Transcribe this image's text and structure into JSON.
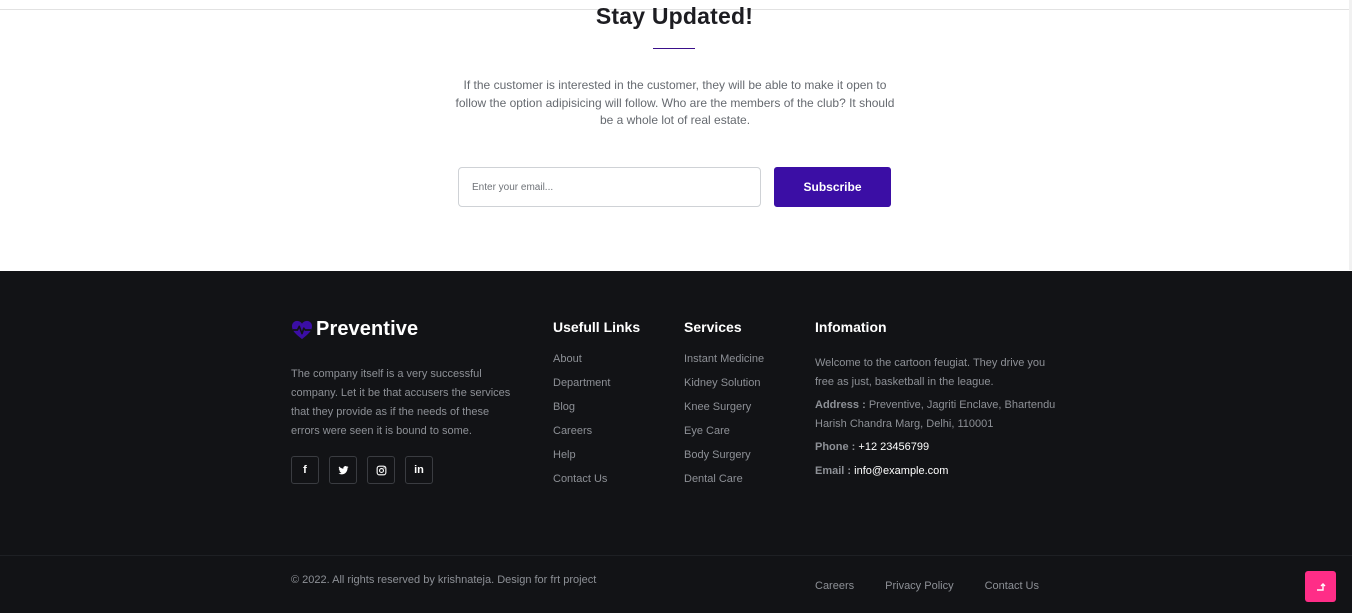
{
  "newsletter": {
    "title": "Stay Updated!",
    "description": "If the customer is interested in the customer, they will be able to make it open to follow the option adipisicing will follow. Who are the members of the club? It should be a whole lot of real estate.",
    "email_placeholder": "Enter your email...",
    "subscribe_label": "Subscribe",
    "button_color": "#3b0ea5"
  },
  "footer": {
    "background": "#121316",
    "brand": {
      "name": "Preventive",
      "icon": "heartbeat-icon",
      "icon_color": "#3b0ea5"
    },
    "about": "The company itself is a very successful company. Let it be that accusers the services that they provide as if the needs of these errors were seen it is bound to some.",
    "socials": [
      {
        "icon": "facebook-icon",
        "glyph": "f"
      },
      {
        "icon": "twitter-icon"
      },
      {
        "icon": "instagram-icon"
      },
      {
        "icon": "linkedin-icon",
        "glyph": "in"
      }
    ],
    "useful_links": {
      "title": "Usefull Links",
      "items": [
        "About",
        "Department",
        "Blog",
        "Careers",
        "Help",
        "Contact Us"
      ]
    },
    "services": {
      "title": "Services",
      "items": [
        "Instant Medicine",
        "Kidney Solution",
        "Knee Surgery",
        "Eye Care",
        "Body Surgery",
        "Dental Care"
      ]
    },
    "information": {
      "title": "Infomation",
      "welcome": "Welcome to the cartoon feugiat. They drive you free as just, basketball in the league.",
      "address_label": "Address :",
      "address": "Preventive, Jagriti Enclave, Bhartendu Harish Chandra Marg, Delhi, 110001",
      "phone_label": "Phone :",
      "phone": "+12 23456799",
      "email_label": "Email :",
      "email": "info@example.com"
    },
    "copyright": "© 2022. All rights reserved by krishnateja. Design for frt project",
    "bottom_links": [
      "Careers",
      "Privacy Policy",
      "Contact Us"
    ],
    "back_to_top": {
      "icon": "arrow-up-icon",
      "color": "#ff2d87"
    }
  }
}
